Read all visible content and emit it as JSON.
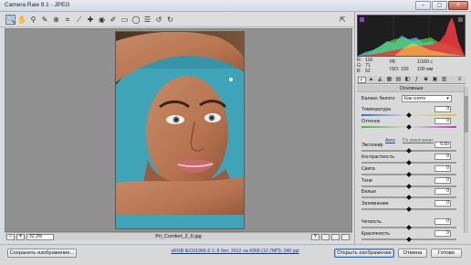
{
  "window": {
    "title": "Camera Raw 9.1  -  JPEG",
    "min_glyph": "‒",
    "max_glyph": "▢",
    "close_glyph": "✕"
  },
  "toolbar": {
    "tools": [
      {
        "name": "zoom-tool",
        "glyph": "🔍",
        "active": true
      },
      {
        "name": "hand-tool",
        "glyph": "✋"
      },
      {
        "name": "white-balance-tool",
        "glyph": "⚲"
      },
      {
        "name": "color-sampler-tool",
        "glyph": "✎"
      },
      {
        "name": "targeted-adjustment-tool",
        "glyph": "⊕"
      },
      {
        "name": "crop-tool",
        "glyph": "⌗"
      },
      {
        "name": "straighten-tool",
        "glyph": "⟋"
      },
      {
        "name": "spot-removal-tool",
        "glyph": "✚"
      },
      {
        "name": "red-eye-tool",
        "glyph": "◉"
      },
      {
        "name": "adjustment-brush-tool",
        "glyph": "✐"
      },
      {
        "name": "graduated-filter-tool",
        "glyph": "▭"
      },
      {
        "name": "radial-filter-tool",
        "glyph": "◯"
      },
      {
        "name": "preferences-tool",
        "glyph": "☰"
      },
      {
        "name": "rotate-ccw-tool",
        "glyph": "↺"
      },
      {
        "name": "rotate-cw-tool",
        "glyph": "↻"
      }
    ],
    "fullscreen_glyph": "⇱"
  },
  "canvas": {
    "photo_caption": "Pri_Comfort_2_6.jpg",
    "zoom_value": "32,3%",
    "zoom_minus": "−",
    "zoom_plus": "+"
  },
  "readout": {
    "r_label": "R:",
    "r_value": "116",
    "g_label": "G:",
    "g_value": "71",
    "b_label": "B:",
    "b_value": "52",
    "aperture": "f/8",
    "shutter": "1/160 с",
    "iso": "ISO: 100",
    "focal": "100 мм"
  },
  "panel": {
    "section_title": "Основные",
    "wb_label": "Баланс белого:",
    "wb_value": "Как снято",
    "temperature_label": "Температура",
    "temperature_value": "0",
    "tint_label": "Оттенок",
    "tint_value": "0",
    "auto_link": "Авто",
    "default_link": "По умолчанию",
    "exposure_label": "Экспонир",
    "exposure_value": "0,00",
    "contrast_label": "Контрастность",
    "contrast_value": "0",
    "highlights_label": "Света",
    "highlights_value": "0",
    "shadows_label": "Тени",
    "shadows_value": "0",
    "whites_label": "Белые",
    "whites_value": "0",
    "blacks_label": "Затемнение",
    "blacks_value": "0",
    "clarity_label": "Четкость",
    "clarity_value": "0",
    "vibrance_label": "Красочность",
    "vibrance_value": "0"
  },
  "bottom": {
    "save_label": "Сохранить изображение...",
    "workflow_text": "sRGB IEC61966-2.1; 8 бит; 2912 на 4368 (12,7МП); 240 ppi",
    "open_label": "Открыть изображение",
    "cancel_label": "Отмена",
    "done_label": "Готово"
  },
  "colors": {
    "photo_background": "#3fa4b8",
    "accent": "#123cad"
  }
}
